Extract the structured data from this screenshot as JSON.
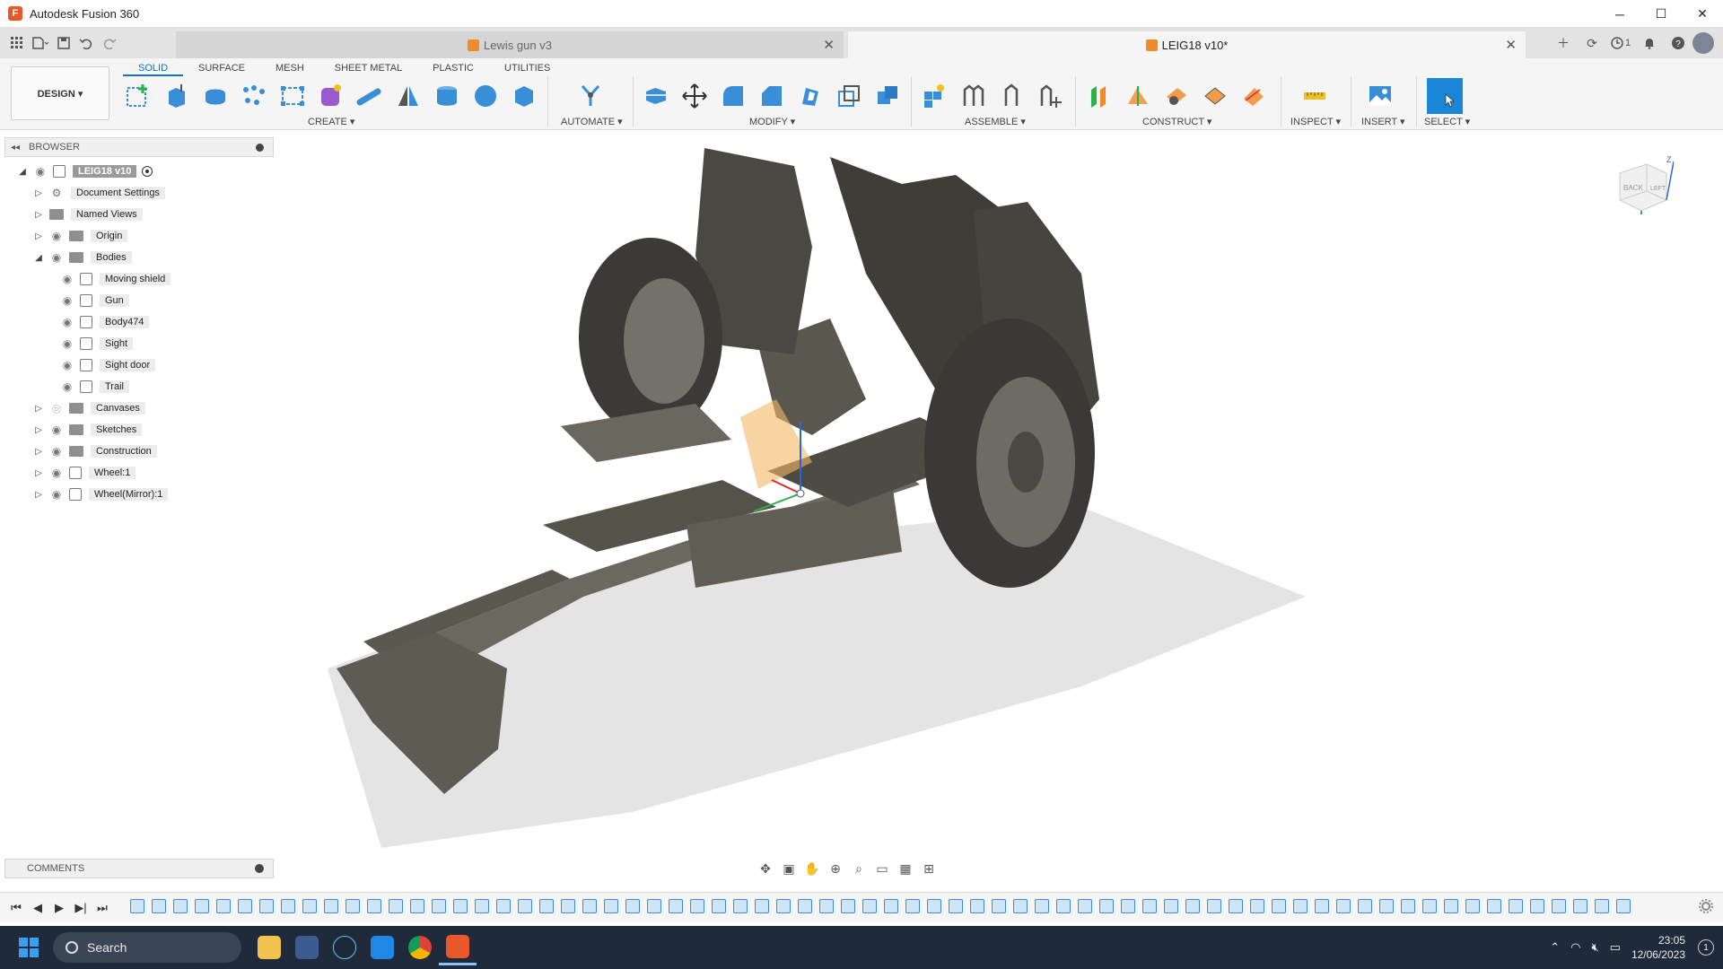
{
  "window": {
    "title": "Autodesk Fusion 360",
    "minimize": "─",
    "maximize": "☐",
    "close": "✕"
  },
  "tabs": [
    {
      "label": "Lewis gun v3",
      "close": "✕"
    },
    {
      "label": "LEIG18 v10*",
      "close": "✕"
    }
  ],
  "header_right": {
    "jobs_count": "1"
  },
  "ribbon": {
    "workspace": "DESIGN ▾",
    "workspace_tabs": [
      "SOLID",
      "SURFACE",
      "MESH",
      "SHEET METAL",
      "PLASTIC",
      "UTILITIES"
    ],
    "groups": [
      "CREATE ▾",
      "AUTOMATE ▾",
      "MODIFY ▾",
      "ASSEMBLE ▾",
      "CONSTRUCT ▾",
      "INSPECT ▾",
      "INSERT ▾",
      "SELECT ▾"
    ]
  },
  "browser": {
    "title": "BROWSER",
    "root": "LEIG18 v10",
    "items": [
      "Document Settings",
      "Named Views",
      "Origin",
      "Bodies",
      "Moving shield",
      "Gun",
      "Body474",
      "Sight",
      "Sight door",
      "Trail",
      "Canvases",
      "Sketches",
      "Construction",
      "Wheel:1",
      "Wheel(Mirror):1"
    ]
  },
  "viewcube": {
    "back": "BACK",
    "left": "LEFT",
    "z": "Z"
  },
  "comments": {
    "title": "COMMENTS"
  },
  "taskbar": {
    "search": "Search",
    "time": "23:05",
    "date": "12/06/2023",
    "notifications": "1"
  },
  "colors": {
    "accent": "#0d72c9",
    "taskbar": "#1f2a3a",
    "fusion_orange": "#e8582a"
  }
}
